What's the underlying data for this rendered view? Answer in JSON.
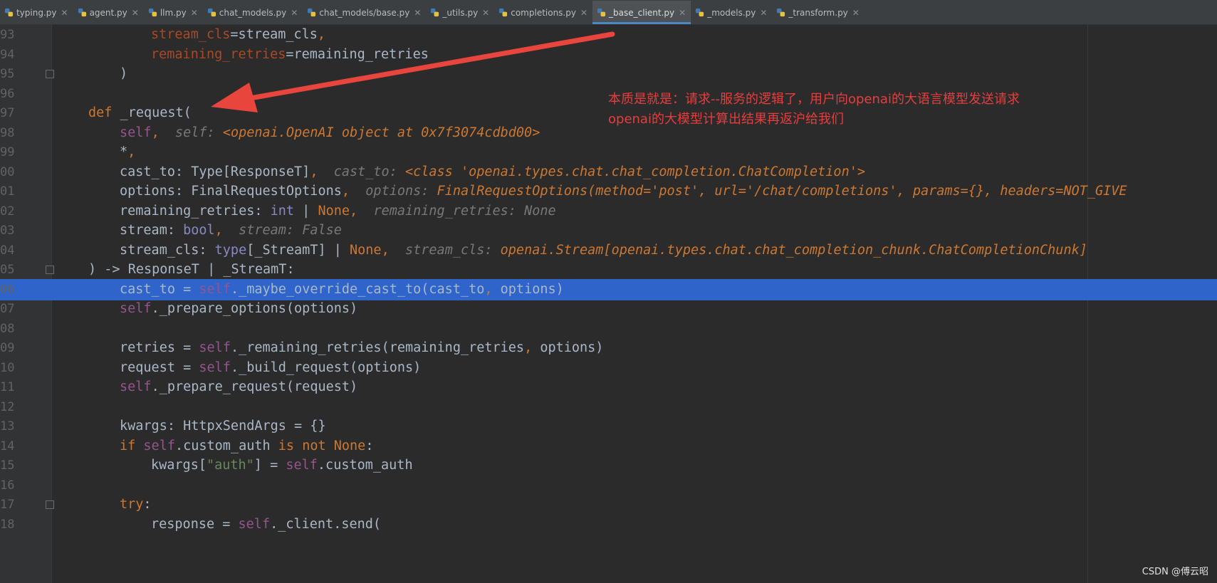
{
  "tabs": [
    {
      "label": "typing.py",
      "active": false
    },
    {
      "label": "agent.py",
      "active": false
    },
    {
      "label": "llm.py",
      "active": false
    },
    {
      "label": "chat_models.py",
      "active": false
    },
    {
      "label": "chat_models/base.py",
      "active": false
    },
    {
      "label": "_utils.py",
      "active": false
    },
    {
      "label": "completions.py",
      "active": false
    },
    {
      "label": "_base_client.py",
      "active": true
    },
    {
      "label": "_models.py",
      "active": false
    },
    {
      "label": "_transform.py",
      "active": false
    }
  ],
  "lines": [
    {
      "num": "93",
      "segs": [
        [
          "stream_cls",
          "param"
        ],
        [
          "=stream_cls",
          "light"
        ],
        [
          ",",
          "punc"
        ]
      ]
    },
    {
      "num": "94",
      "segs": [
        [
          "remaining_retries",
          "param"
        ],
        [
          "=remaining_retries",
          "light"
        ]
      ]
    },
    {
      "num": "95",
      "segs": [
        [
          ")",
          "light"
        ]
      ]
    },
    {
      "num": "96",
      "segs": []
    },
    {
      "num": "97",
      "segs": [
        [
          "def ",
          "kw"
        ],
        [
          "_request",
          "light"
        ],
        [
          "(",
          "light"
        ]
      ]
    },
    {
      "num": "98",
      "segs": [
        [
          "self",
          "self"
        ],
        [
          ",  ",
          "punc"
        ],
        [
          "self: ",
          "hint-name"
        ],
        [
          "<openai.OpenAI object at 0x7f3074cdbd00>",
          "hint-val"
        ]
      ]
    },
    {
      "num": "99",
      "segs": [
        [
          "*",
          "light"
        ],
        [
          ",",
          "punc"
        ]
      ]
    },
    {
      "num": "00",
      "segs": [
        [
          "cast_to: Type[ResponseT]",
          "light"
        ],
        [
          ",  ",
          "punc"
        ],
        [
          "cast_to: ",
          "hint-name"
        ],
        [
          "<class 'openai.types.chat.chat_completion.ChatCompletion'>",
          "hint-val"
        ]
      ]
    },
    {
      "num": "01",
      "segs": [
        [
          "options: FinalRequestOptions",
          "light"
        ],
        [
          ",  ",
          "punc"
        ],
        [
          "options: ",
          "hint-name"
        ],
        [
          "FinalRequestOptions(method='post', url='/chat/completions', params={}, headers=NOT_GIVE",
          "hint-val"
        ]
      ]
    },
    {
      "num": "02",
      "segs": [
        [
          "remaining_retries: ",
          "light"
        ],
        [
          "int",
          "bi"
        ],
        [
          " | ",
          "light"
        ],
        [
          "None",
          "kw"
        ],
        [
          ",  ",
          "punc"
        ],
        [
          "remaining_retries: None",
          "hint-name"
        ]
      ]
    },
    {
      "num": "03",
      "segs": [
        [
          "stream: ",
          "light"
        ],
        [
          "bool",
          "bi"
        ],
        [
          ",  ",
          "punc"
        ],
        [
          "stream: False",
          "hint-name"
        ]
      ]
    },
    {
      "num": "04",
      "segs": [
        [
          "stream_cls: ",
          "light"
        ],
        [
          "type",
          "bi"
        ],
        [
          "[_StreamT] | ",
          "light"
        ],
        [
          "None",
          "kw"
        ],
        [
          ",  ",
          "punc"
        ],
        [
          "stream_cls: ",
          "hint-name"
        ],
        [
          "openai.Stream[openai.types.chat.chat_completion_chunk.ChatCompletionChunk]",
          "hint-val"
        ]
      ]
    },
    {
      "num": "05",
      "segs": [
        [
          ") -> ResponseT | _StreamT:",
          "light"
        ]
      ]
    },
    {
      "num": "06",
      "segs": [
        [
          "cast_to = ",
          "light"
        ],
        [
          "self",
          "self"
        ],
        [
          "._maybe_override_cast_to(cast_to",
          "light"
        ],
        [
          ",",
          "punc"
        ],
        [
          " options)",
          "light"
        ]
      ]
    },
    {
      "num": "07",
      "segs": [
        [
          "self",
          "self"
        ],
        [
          "._prepare_options(options)",
          "light"
        ]
      ]
    },
    {
      "num": "08",
      "segs": []
    },
    {
      "num": "09",
      "segs": [
        [
          "retries = ",
          "light"
        ],
        [
          "self",
          "self"
        ],
        [
          "._remaining_retries(remaining_retries",
          "light"
        ],
        [
          ",",
          "punc"
        ],
        [
          " options)",
          "light"
        ]
      ]
    },
    {
      "num": "10",
      "segs": [
        [
          "request = ",
          "light"
        ],
        [
          "self",
          "self"
        ],
        [
          "._build_request(options)",
          "light"
        ]
      ]
    },
    {
      "num": "11",
      "segs": [
        [
          "self",
          "self"
        ],
        [
          "._prepare_request(request)",
          "light"
        ]
      ]
    },
    {
      "num": "12",
      "segs": []
    },
    {
      "num": "13",
      "segs": [
        [
          "kwargs: HttpxSendArgs = {}",
          "light"
        ]
      ]
    },
    {
      "num": "14",
      "segs": [
        [
          "if ",
          "kw"
        ],
        [
          "self",
          "self"
        ],
        [
          ".custom_auth ",
          "light"
        ],
        [
          "is not ",
          "kw"
        ],
        [
          "None",
          "kw"
        ],
        [
          ":",
          "light"
        ]
      ]
    },
    {
      "num": "15",
      "segs": [
        [
          "kwargs[",
          "light"
        ],
        [
          "\"auth\"",
          "str"
        ],
        [
          "] = ",
          "light"
        ],
        [
          "self",
          "self"
        ],
        [
          ".custom_auth",
          "light"
        ]
      ]
    },
    {
      "num": "16",
      "segs": []
    },
    {
      "num": "17",
      "segs": [
        [
          "try",
          "kw"
        ],
        [
          ":",
          "light"
        ]
      ]
    },
    {
      "num": "18",
      "segs": [
        [
          "response",
          "light"
        ],
        [
          " = ",
          "light"
        ],
        [
          "self",
          "self"
        ],
        [
          "._client.send(",
          "light"
        ]
      ]
    }
  ],
  "annotation": {
    "line1": "本质是就是：请求--服务的逻辑了，用户向openai的大语言模型发送请求",
    "line2": "openai的大模型计算出结果再返沪给我们"
  },
  "watermark": "CSDN @傅云昭"
}
